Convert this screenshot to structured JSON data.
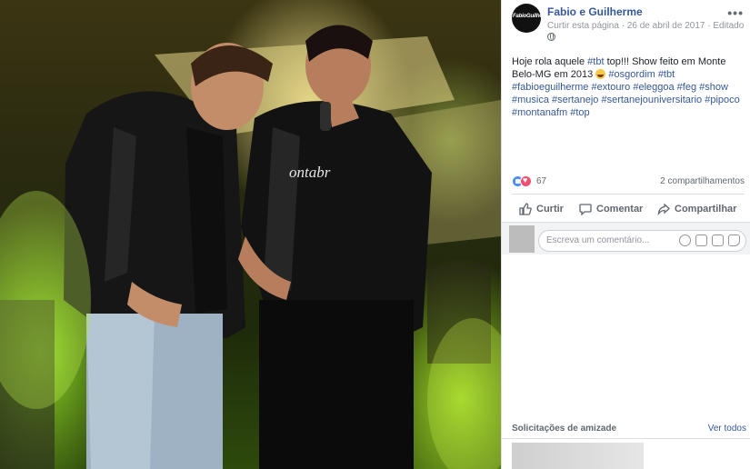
{
  "post": {
    "page_name": "Fabio e Guilherme",
    "avatar_text": "FabioGuilherme",
    "like_page": "Curtir esta página",
    "date": "26 de abril de 2017",
    "edited": "Editado",
    "more": "•••",
    "text_intro": "Hoje rola aquele ",
    "tag_tbt": "#tbt",
    "text_mid": " top!!! Show feito em Monte Belo-MG em 2013 ",
    "tag_osgordim": "#osgordim",
    "tag_tbt2": "#tbt",
    "hashtags": [
      "#fabioeguilherme",
      "#extouro",
      "#eleggoa",
      "#feg",
      "#show",
      "#musica",
      "#sertanejo",
      "#sertanejouniversitario",
      "#pipoco",
      "#montanafm",
      "#top"
    ]
  },
  "reactions": {
    "count": "67",
    "shares": "2 compartilhamentos"
  },
  "actions": {
    "like": "Curtir",
    "comment": "Comentar",
    "share": "Compartilhar"
  },
  "comment_box": {
    "placeholder": "Escreva um comentário..."
  },
  "friend_requests": {
    "title": "Solicitações de amizade",
    "see_all": "Ver todos"
  },
  "photo": {
    "shirt_text": "ontabr"
  },
  "colors": {
    "link": "#365899",
    "muted": "#90949c",
    "love": "#f0506e",
    "like": "#4a8ff5"
  }
}
